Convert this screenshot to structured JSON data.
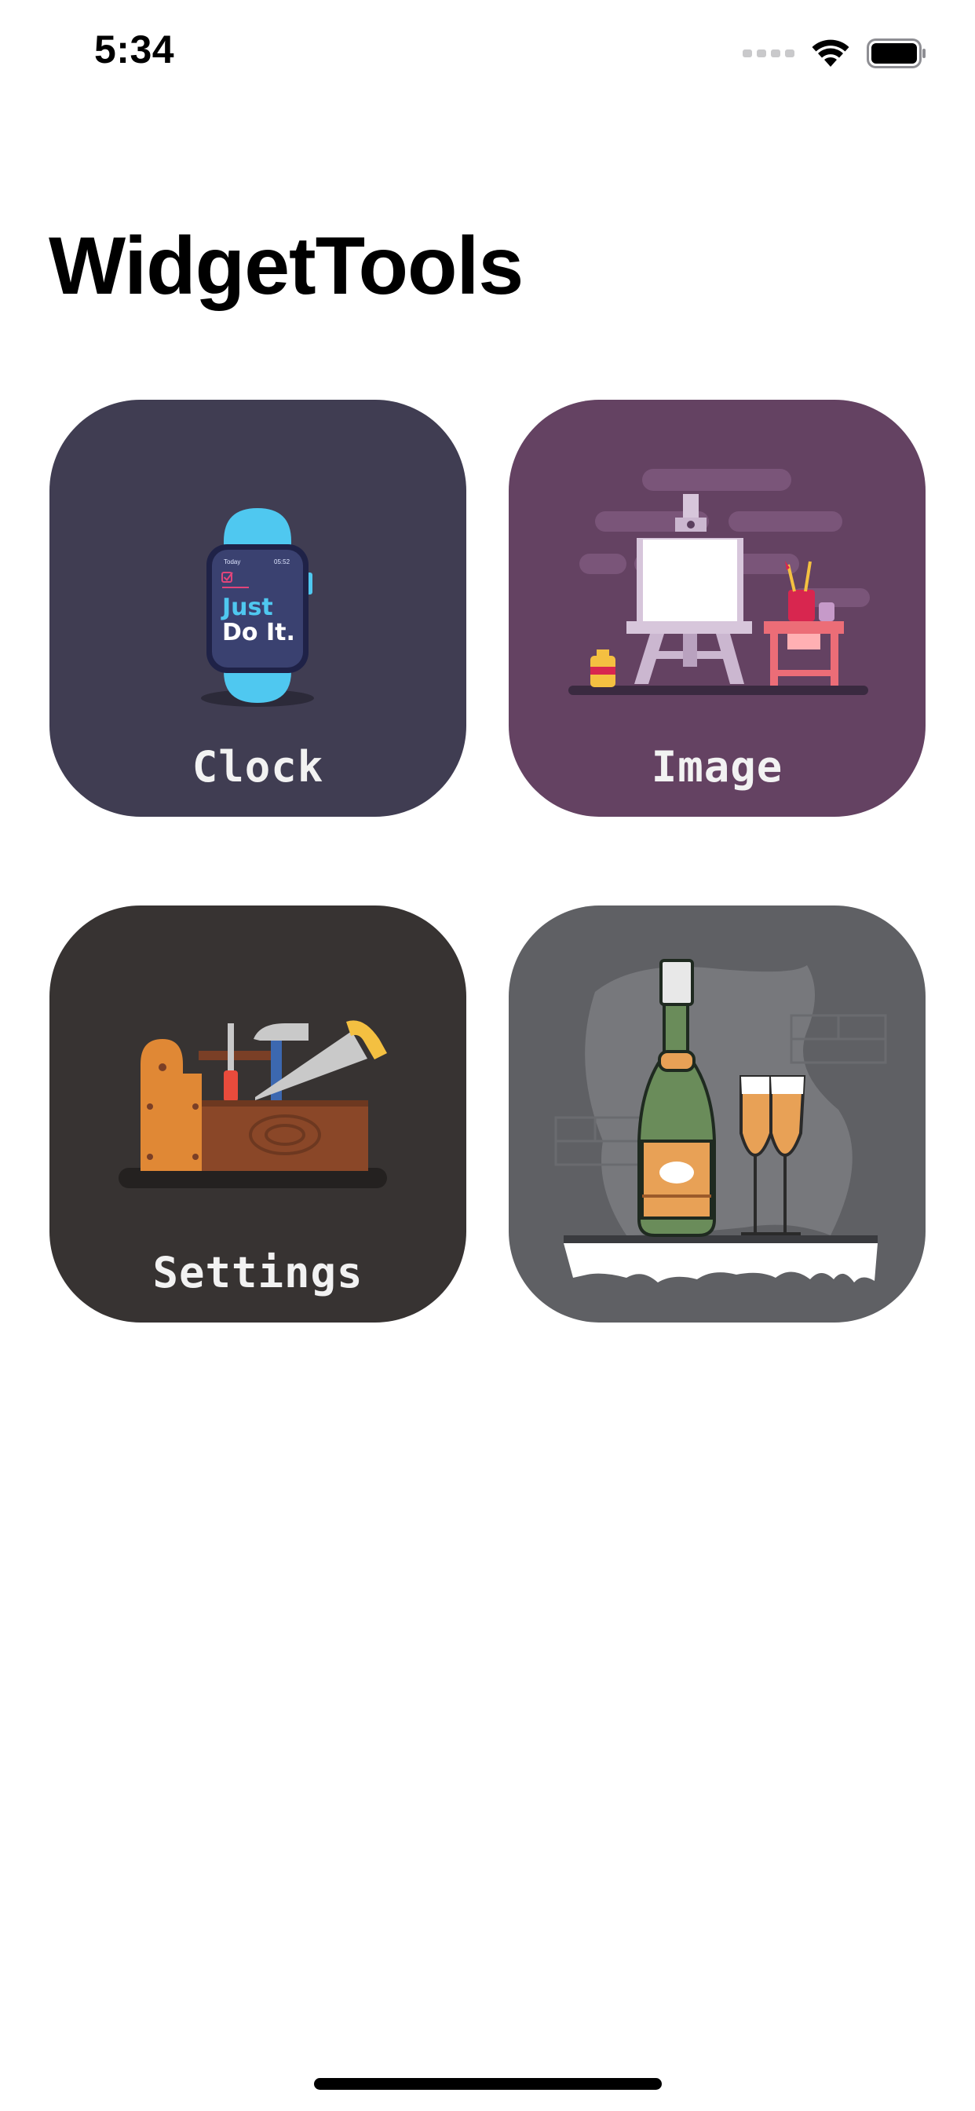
{
  "status_bar": {
    "time": "5:34",
    "icons": [
      "cellular-signal-icon",
      "wifi-icon",
      "battery-icon"
    ]
  },
  "header": {
    "title": "WidgetTools"
  },
  "tiles": [
    {
      "label": "Clock",
      "icon": "smartwatch-icon",
      "color": "#403d52"
    },
    {
      "label": "Image",
      "icon": "easel-canvas-icon",
      "color": "#644262"
    },
    {
      "label": "Settings",
      "icon": "toolbox-icon",
      "color": "#373332"
    },
    {
      "label": "",
      "icon": "champagne-icon",
      "color": "#5f6064"
    }
  ],
  "watch_face": {
    "top_left": "Today",
    "top_right": "05:52",
    "line1": "Just",
    "line2": "Do It."
  },
  "colors": {
    "background": "#ffffff",
    "title": "#000000",
    "tile_label": "#f2f2f2",
    "watch_band": "#4fc8f0"
  }
}
